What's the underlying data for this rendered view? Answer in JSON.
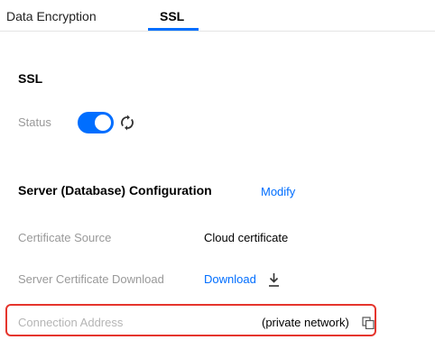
{
  "tabs": [
    {
      "label": "Data Encryption",
      "active": false
    },
    {
      "label": "SSL",
      "active": true
    }
  ],
  "ssl": {
    "title": "SSL",
    "status_label": "Status",
    "status_on": true
  },
  "config": {
    "title": "Server (Database) Configuration",
    "modify_label": "Modify",
    "certificate_source_label": "Certificate Source",
    "certificate_source_value": "Cloud certificate",
    "server_cert_download_label": "Server Certificate Download",
    "download_label": "Download",
    "connection_address_label": "Connection Address",
    "connection_address_value": "(private network)"
  },
  "colors": {
    "accent": "#006eff",
    "highlight": "#e5352d",
    "muted_label": "#999999"
  },
  "icons": [
    "refresh-icon",
    "download-icon",
    "copy-icon"
  ]
}
